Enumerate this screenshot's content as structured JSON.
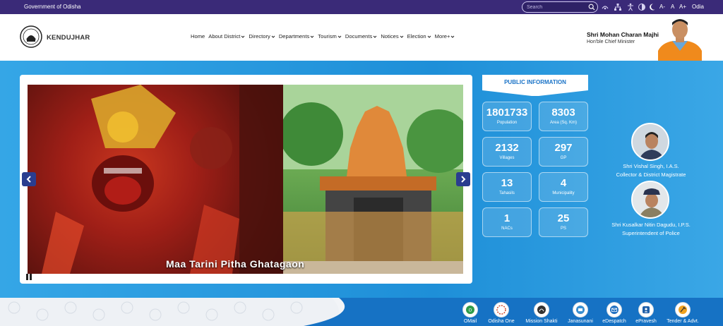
{
  "topbar": {
    "government": "Government of Odisha",
    "search_placeholder": "Search",
    "font_decrease": "A-",
    "font_normal": "A",
    "font_increase": "A+",
    "language": "Odia"
  },
  "header": {
    "site_name": "KENDUJHAR",
    "nav": [
      {
        "label": "Home",
        "dropdown": false
      },
      {
        "label": "About District",
        "dropdown": true
      },
      {
        "label": "Directory",
        "dropdown": true
      },
      {
        "label": "Departments",
        "dropdown": true
      },
      {
        "label": "Tourism",
        "dropdown": true
      },
      {
        "label": "Documents",
        "dropdown": true
      },
      {
        "label": "Notices",
        "dropdown": true
      },
      {
        "label": "Election",
        "dropdown": true
      },
      {
        "label": "More+",
        "dropdown": true
      }
    ],
    "cm_name": "Shri Mohan Charan Majhi",
    "cm_role": "Hon'ble Chief Minister"
  },
  "slider": {
    "caption": "Maa Tarini Pitha Ghatagaon"
  },
  "public_info": {
    "title": "PUBLIC INFORMATION",
    "stats": [
      {
        "value": "1801733",
        "label": "Population"
      },
      {
        "value": "8303",
        "label": "Area (Sq. Km)"
      },
      {
        "value": "2132",
        "label": "Villages"
      },
      {
        "value": "297",
        "label": "GP"
      },
      {
        "value": "13",
        "label": "Tahasils"
      },
      {
        "value": "4",
        "label": "Municipality"
      },
      {
        "value": "1",
        "label": "NACs"
      },
      {
        "value": "25",
        "label": "PS"
      }
    ]
  },
  "officials": [
    {
      "name": "Shri Vishal Singh, I.A.S.",
      "role": "Collector & District Magistrate"
    },
    {
      "name": "Shri Kusalkar Nitin Dagudu, I.P.S.",
      "role": "Superintendent of Police"
    }
  ],
  "quick_links": [
    {
      "label": "OMail",
      "icon": "omail-icon"
    },
    {
      "label": "Odisha One",
      "icon": "odisha-one-icon"
    },
    {
      "label": "Mission Shakti",
      "icon": "mission-shakti-icon"
    },
    {
      "label": "Janasunani",
      "icon": "janasunani-icon"
    },
    {
      "label": "eDespatch",
      "icon": "edespatch-icon"
    },
    {
      "label": "ePravesh",
      "icon": "epravesh-icon"
    },
    {
      "label": "Tender & Advt.",
      "icon": "tender-icon"
    }
  ],
  "colors": {
    "topbar": "#3a2a78",
    "main_blue": "#1e8fd8",
    "nav_arrow": "#2a3d8f",
    "footer_blue": "#1672c4"
  }
}
